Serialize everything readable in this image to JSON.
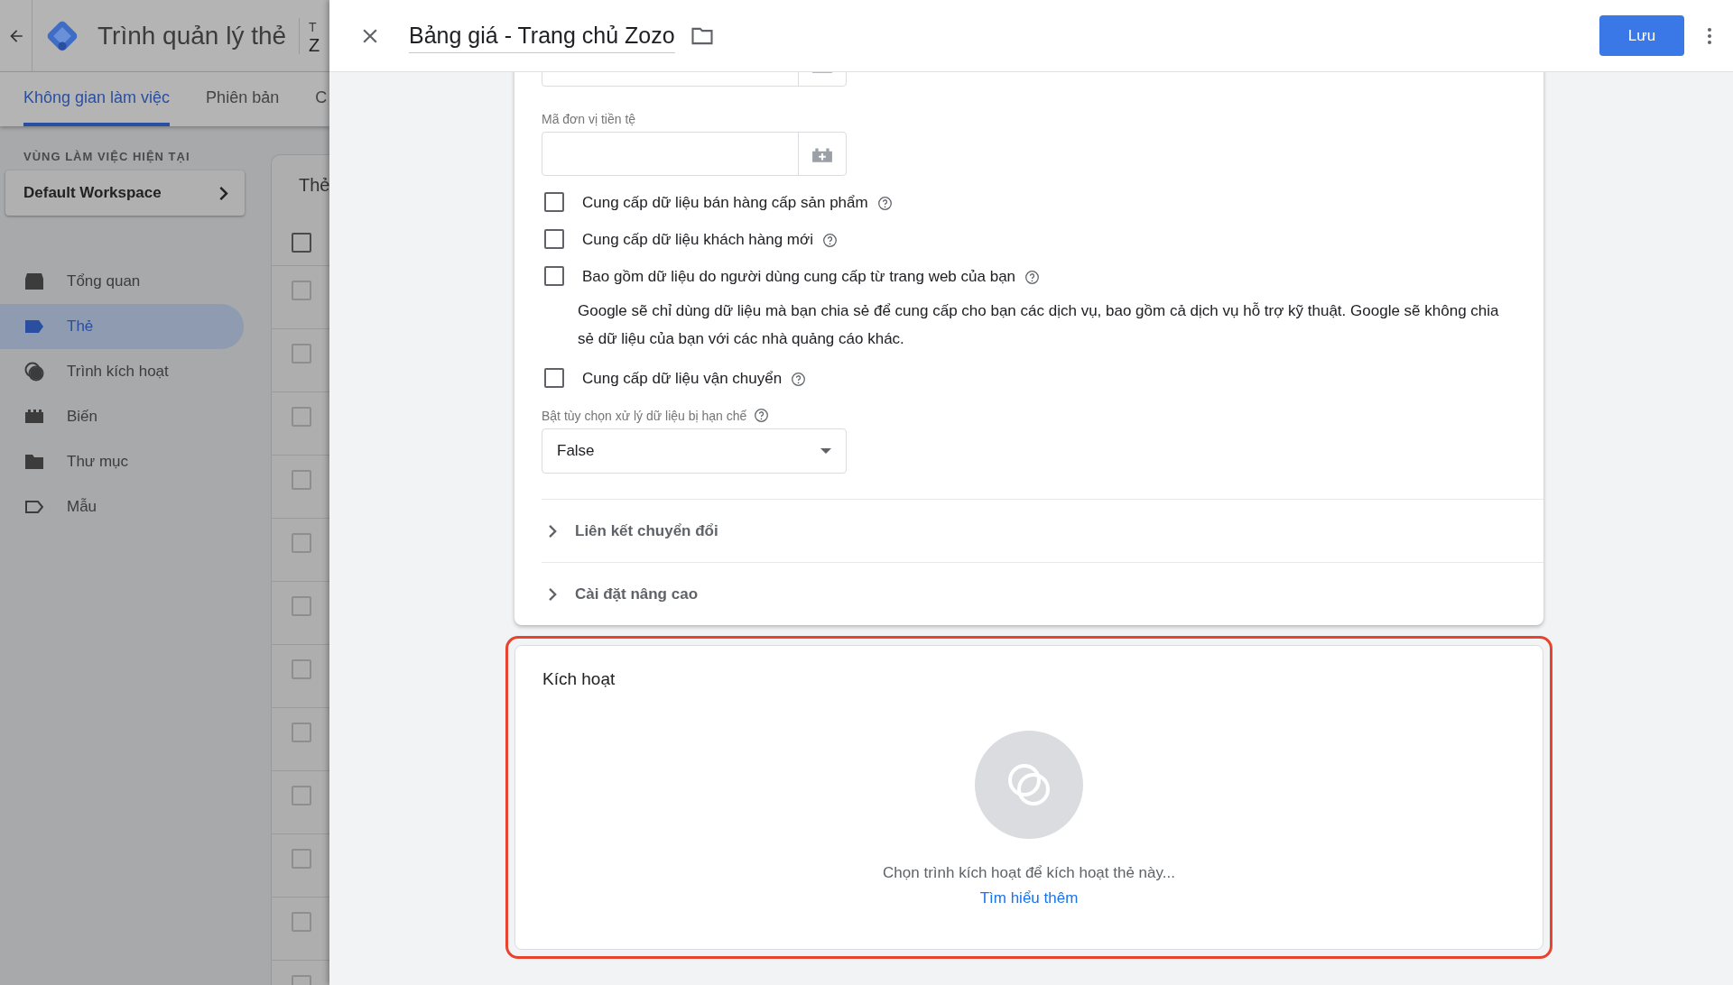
{
  "app": {
    "title": "Trình quản lý thẻ",
    "context_lines": [
      "T",
      "Z"
    ]
  },
  "tabs": [
    {
      "label": "Không gian làm việc",
      "selected": true
    },
    {
      "label": "Phiên bản",
      "selected": false
    },
    {
      "label": "C",
      "selected": false
    }
  ],
  "workspace": {
    "heading": "VÙNG LÀM VIỆC HIỆN TẠI",
    "name": "Default Workspace"
  },
  "nav": [
    {
      "kind": "overview",
      "label": "Tổng quan",
      "selected": false
    },
    {
      "kind": "tags",
      "label": "Thẻ",
      "selected": true
    },
    {
      "kind": "triggers",
      "label": "Trình kích hoạt",
      "selected": false
    },
    {
      "kind": "variables",
      "label": "Biến",
      "selected": false
    },
    {
      "kind": "folders",
      "label": "Thư mục",
      "selected": false
    },
    {
      "kind": "templates",
      "label": "Mẫu",
      "selected": false
    }
  ],
  "tag_list": {
    "title": "Thẻ",
    "header_checked": false,
    "rows": [
      {
        "checked": false
      },
      {
        "checked": false
      },
      {
        "checked": false
      },
      {
        "checked": false
      },
      {
        "checked": false
      },
      {
        "checked": false
      },
      {
        "checked": false
      },
      {
        "checked": false
      },
      {
        "checked": false
      },
      {
        "checked": false
      },
      {
        "checked": false
      },
      {
        "checked": false
      }
    ]
  },
  "editor": {
    "title": "Bảng giá - Trang chủ Zozo",
    "save": "Lưu"
  },
  "config": {
    "currency_label": "Mã đơn vị tiền tệ",
    "options": [
      {
        "label": "Cung cấp dữ liệu bán hàng cấp sản phẩm",
        "checked": false
      },
      {
        "label": "Cung cấp dữ liệu khách hàng mới",
        "checked": false
      },
      {
        "label": "Bao gồm dữ liệu do người dùng cung cấp từ trang web của bạn",
        "checked": false,
        "note": "Google sẽ chỉ dùng dữ liệu mà bạn chia sẻ để cung cấp cho bạn các dịch vụ, bao gồm cả dịch vụ hỗ trợ kỹ thuật. Google sẽ không chia sẻ dữ liệu của bạn với các nhà quảng cáo khác."
      },
      {
        "label": "Cung cấp dữ liệu vận chuyển",
        "checked": false
      }
    ],
    "restricted": {
      "label": "Bật tùy chọn xử lý dữ liệu bị hạn chế",
      "value": "False"
    },
    "sections": [
      {
        "label": "Liên kết chuyển đổi",
        "expanded": false
      },
      {
        "label": "Cài đặt nâng cao",
        "expanded": false
      }
    ]
  },
  "triggering": {
    "title": "Kích hoạt",
    "hint": "Chọn trình kích hoạt để kích hoạt thẻ này...",
    "link": "Tìm hiểu thêm",
    "highlighted": true
  }
}
